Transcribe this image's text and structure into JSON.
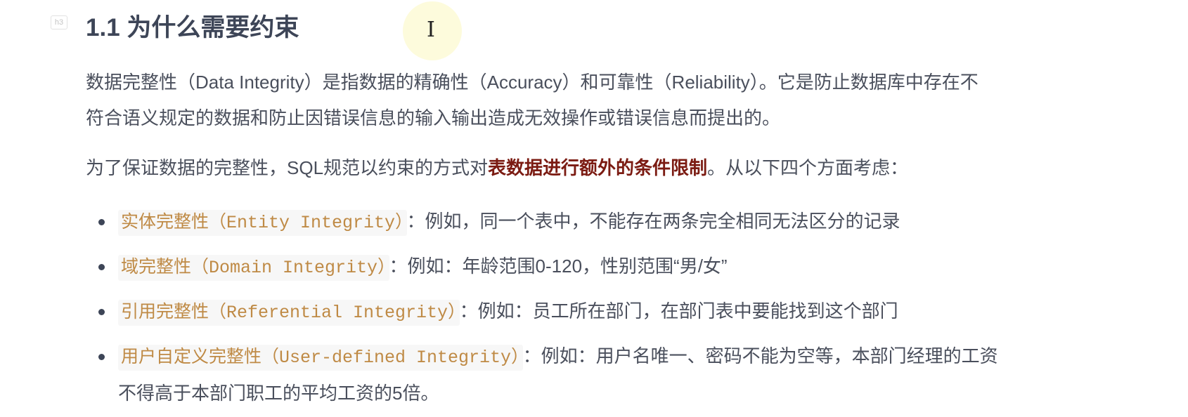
{
  "heading": {
    "badge": "h3",
    "title": "1.1 为什么需要约束"
  },
  "paragraph1": {
    "line1": "数据完整性（Data Integrity）是指数据的精确性（Accuracy）和可靠性（Reliability）。它是防止数据库中存在不",
    "line2": "符合语义规定的数据和防止因错误信息的输入输出造成无效操作或错误信息而提出的。"
  },
  "paragraph2": {
    "before": "为了保证数据的完整性，SQL规范以约束的方式对",
    "bold": "表数据进行额外的条件限制",
    "after": "。从以下四个方面考虑："
  },
  "list": [
    {
      "code": "实体完整性（Entity Integrity）",
      "text": "：例如，同一个表中，不能存在两条完全相同无法区分的记录"
    },
    {
      "code": "域完整性（Domain Integrity）",
      "text": "：例如：年龄范围0-120，性别范围“男/女”"
    },
    {
      "code": "引用完整性（Referential Integrity）",
      "text": "：例如：员工所在部门，在部门表中要能找到这个部门"
    },
    {
      "code": "用户自定义完整性（User-defined Integrity）",
      "text": "：例如：用户名唯一、密码不能为空等，本部门经理的工资",
      "continuation": "不得高于本部门职工的平均工资的5倍。"
    }
  ],
  "colors": {
    "bold": "#7b1b12",
    "code": "#bf8a45",
    "text": "#4a4f5c",
    "heading": "#3d4557"
  }
}
